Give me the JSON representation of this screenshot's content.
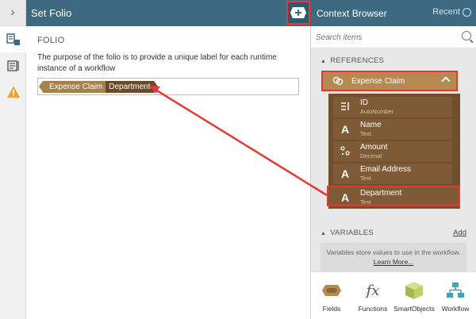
{
  "left_rail": {
    "collapse_glyph": "›"
  },
  "main": {
    "title": "Set Folio",
    "section_label": "FOLIO",
    "description": "The purpose of the folio is to provide a unique label for each runtime instance of a workflow",
    "folio_tokens": [
      "Expense Claim",
      "Department"
    ]
  },
  "context_browser": {
    "title": "Context Browser",
    "recent_label": "Recent",
    "search_placeholder": "Search items",
    "references_label": "REFERENCES",
    "reference_name": "Expense Claim",
    "fields": [
      {
        "name": "ID",
        "type": "AutoNumber",
        "icon": "autonumber-icon"
      },
      {
        "name": "Name",
        "type": "Text",
        "icon": "text-icon"
      },
      {
        "name": "Amount",
        "type": "Decimal",
        "icon": "decimal-icon"
      },
      {
        "name": "Email Address",
        "type": "Text",
        "icon": "text-icon"
      },
      {
        "name": "Department",
        "type": "Text",
        "icon": "text-icon"
      }
    ],
    "variables_label": "VARIABLES",
    "add_label": "Add",
    "variables_text": "Variables store values to use in the workflow.",
    "learn_more": "Learn More..."
  },
  "tabs": [
    {
      "label": "Fields",
      "icon": "fields-icon"
    },
    {
      "label": "Functions",
      "icon": "functions-icon"
    },
    {
      "label": "SmartObjects",
      "icon": "smartobjects-icon"
    },
    {
      "label": "Workflow",
      "icon": "workflow-icon"
    }
  ],
  "colors": {
    "header": "#3d6a80",
    "highlight": "#e53935",
    "brown_light": "#b5894f",
    "brown_dark": "#6e4f2f"
  }
}
